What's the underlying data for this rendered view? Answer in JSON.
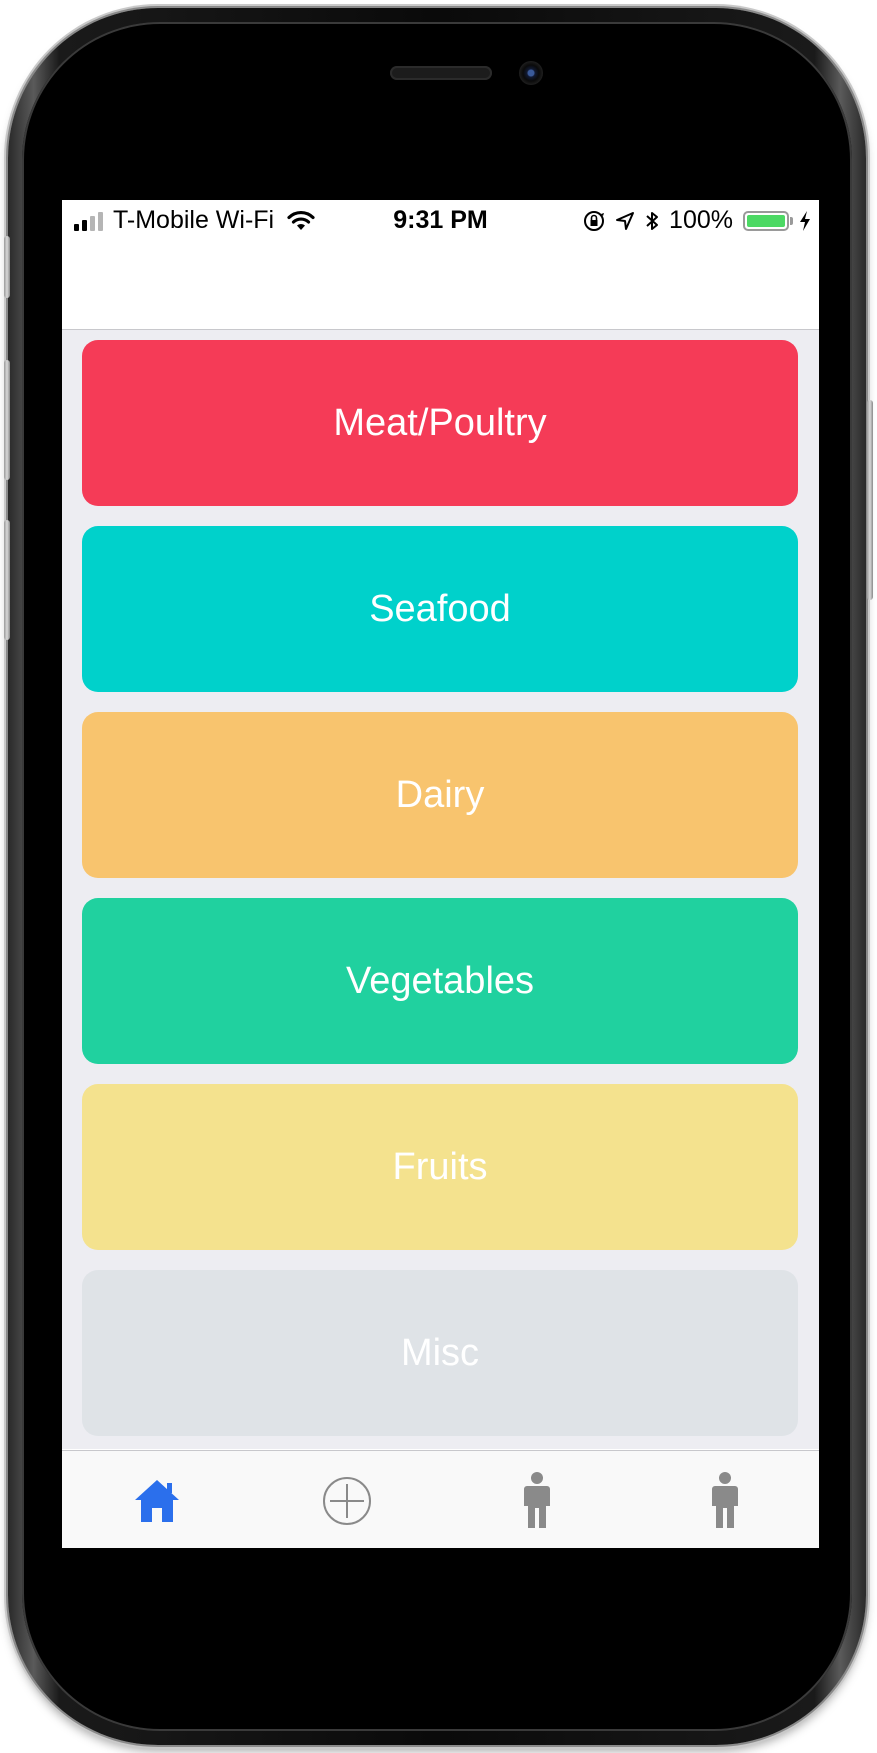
{
  "status_bar": {
    "carrier": "T-Mobile Wi-Fi",
    "time": "9:31 PM",
    "battery_percent": "100%",
    "battery_level": 1.0,
    "signal_bars_filled": 2,
    "signal_bars_total": 4,
    "icons": [
      "signal-icon",
      "wifi-icon",
      "rotation-lock-icon",
      "location-icon",
      "bluetooth-icon",
      "battery-icon",
      "charging-icon"
    ]
  },
  "categories": [
    {
      "label": "Meat/Poultry",
      "color": "#f53b57"
    },
    {
      "label": "Seafood",
      "color": "#00d1cb"
    },
    {
      "label": "Dairy",
      "color": "#f8c46e"
    },
    {
      "label": "Vegetables",
      "color": "#20d19f"
    },
    {
      "label": "Fruits",
      "color": "#f4e28e"
    },
    {
      "label": "Misc",
      "color": "#dfe3e7"
    }
  ],
  "tab_bar": {
    "active_color": "#2b6fec",
    "inactive_color": "#8a8a8a",
    "tabs": [
      {
        "icon": "home-icon",
        "active": true
      },
      {
        "icon": "add-circle-icon",
        "active": false
      },
      {
        "icon": "person-icon",
        "active": false
      },
      {
        "icon": "person-icon",
        "active": false
      }
    ]
  }
}
